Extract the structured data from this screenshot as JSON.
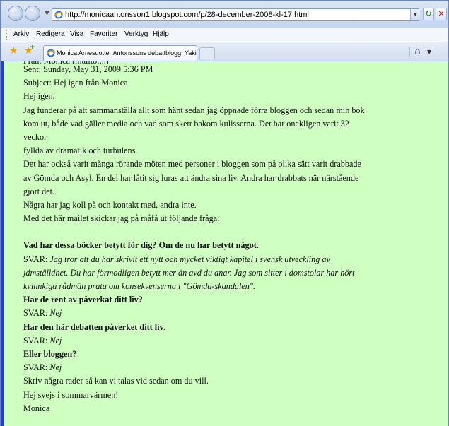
{
  "browser": {
    "url": "http://monicaantonsson1.blogspot.com/p/28-december-2008-kl-17.html",
    "menu": [
      "Arkiv",
      "Redigera",
      "Visa",
      "Favoriter",
      "Verktyg",
      "Hjälp"
    ],
    "tab_title": "Monica Arnesdotter Antonssons debattblogg: Yakidas...",
    "icons": {
      "back": "back-arrow-icon",
      "forward": "forward-arrow-icon",
      "history_dropdown": "chevron-down-icon",
      "page": "internet-explorer-icon",
      "refresh": "refresh-icon",
      "stop": "stop-icon",
      "favorites": "star-icon",
      "add_favorite": "star-plus-icon",
      "home": "home-icon"
    }
  },
  "email": {
    "sent_line": "Sent: Sunday, May 31, 2009 5:36 PM",
    "subject_line": "Subject: Hej igen från Monica",
    "greeting": "Hej igen,",
    "p1_l1": "Jag funderar på att sammanställa allt som hänt sedan jag öppnade förra bloggen och sedan min bok",
    "p1_l2": "kom ut, både vad gäller media och vad som skett bakom kulisserna. Det har onekligen varit 32",
    "p1_l3": "veckor",
    "p1_l4": "fyllda av dramatik och turbulens.",
    "p2_l1": "Det har också varit många rörande möten med personer i bloggen som på olika sätt varit drabbade",
    "p2_l2": "av Gömda och Asyl. En del har låtit sig luras att ändra sina liv. Andra har drabbats när närstående",
    "p2_l3": "gjort det.",
    "p3": "Några har jag koll på och kontakt med, andra inte.",
    "p4": "Med det här mailet skickar jag på måfå ut följande fråga:",
    "q1": "Vad har dessa böcker betytt för dig? Om de nu har betytt något.",
    "a1_prefix": "SVAR: ",
    "a1_l1": "Jag tror att du har skrivit ett nytt och mycket viktigt kapitel i svensk utveckling av",
    "a1_l2": "jämställdhet. Du har förmodligen betytt mer än avd du anar. Jag som sitter i domstolar har hört",
    "a1_l3": "kvinnkiga rådmän prata om konsekvenserna i \"Gömda-skandalen\".",
    "q2": "Har de rent av påverkat ditt liv?",
    "a2_prefix": "SVAR: ",
    "a2": "Nej",
    "q3": "Har den här debatten påverket ditt liv.",
    "a3_prefix": "SVAR: ",
    "a3": "Nej",
    "q4": "Eller bloggen?",
    "a4_prefix": "SVAR: ",
    "a4": "Nej",
    "closing1": "Skriv några rader så kan vi talas vid sedan om du vill.",
    "closing2": "Hej svejs i sommarvärmen!",
    "signature": "Monica"
  },
  "colors": {
    "content_bg": "#cfffc1",
    "left_border": "#1d3fd6"
  }
}
